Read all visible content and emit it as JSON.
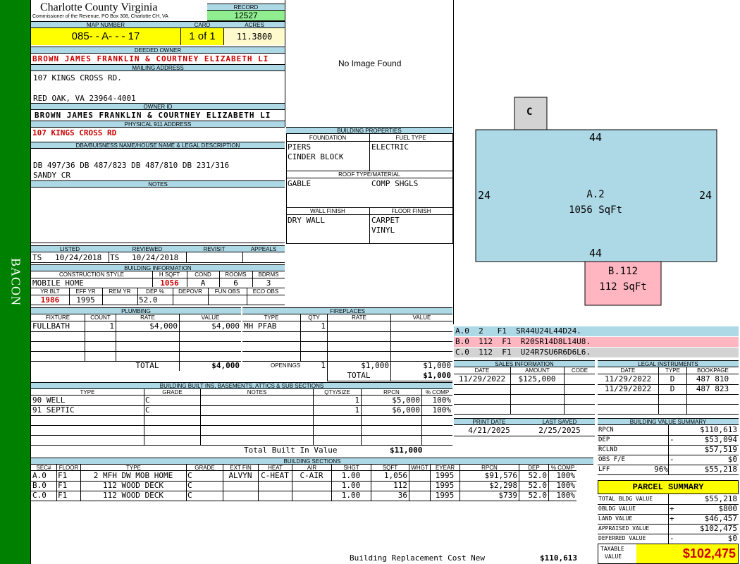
{
  "sidebar": {
    "district": "BACON"
  },
  "county": {
    "title": "Charlotte County Virginia",
    "sub": "Commissioner of the Revenue, PO Box 308, Charlotte CH, VA"
  },
  "record": {
    "label": "RECORD",
    "value": "12527"
  },
  "map": {
    "label": "MAP NUMBER",
    "value": "085- - A- - - 17"
  },
  "card": {
    "label": "CARD",
    "value": "1 of 1"
  },
  "acres": {
    "label": "ACRES",
    "value": "11.3800"
  },
  "owner": {
    "label": "DEEDED OWNER",
    "value": "BROWN JAMES FRANKLIN & COURTNEY ELIZABETH LI"
  },
  "mailing": {
    "label": "MAILING ADDRESS",
    "line1": "107 KINGS CROSS RD.",
    "line2": "RED OAK, VA 23964-4001"
  },
  "owner_id": {
    "label": "OWNER ID",
    "value": "BROWN JAMES FRANKLIN & COURTNEY ELIZABETH LI"
  },
  "address911": {
    "label": "PHYSICAL 911 ADDRESS",
    "value": "107 KINGS CROSS RD"
  },
  "legal": {
    "label": "DBA/BUISNESS NAME/HOUSE NAME & LEGAL DESCRIPTION",
    "line1": "DB 497/36 DB 487/823 DB 487/810 DB 231/316",
    "line2": "SANDY CR"
  },
  "notes": {
    "label": "NOTES"
  },
  "image": {
    "text": "No Image Found"
  },
  "status": {
    "listed_label": "LISTED",
    "listed_by": "TS",
    "listed": "10/24/2018",
    "reviewed_label": "REVIEWED",
    "reviewed_by": "TS",
    "reviewed": "10/24/2018",
    "revisit_label": "REVISIT",
    "appeals_label": "APPEALS"
  },
  "bldg_info": {
    "label": "BUILDING INFORMATION",
    "style_label": "CONSTRUCTION STYLE",
    "style": "MOBILE HOME",
    "hsqft_label": "H SQFT",
    "hsqft": "1056",
    "cond_label": "COND",
    "cond": "A",
    "rooms_label": "ROOMS",
    "rooms": "6",
    "bdrms_label": "BDRMS",
    "bdrms": "3",
    "yrblt_label": "YR BLT",
    "yrblt": "1986",
    "effyr_label": "EFF YR",
    "effyr": "1995",
    "remyr_label": "REM YR",
    "deppct_label": "DEP %",
    "deppct": "52.0",
    "depovr_label": "DEPOVR",
    "funobs_label": "FUN OBS",
    "ecoobs_label": "ECO OBS"
  },
  "bldg_props": {
    "label": "BUILDING PROPERTIES",
    "foundation_label": "FOUNDATION",
    "foundation1": "PIERS",
    "foundation2": "CINDER BLOCK",
    "fuel_label": "FUEL TYPE",
    "fuel": "ELECTRIC",
    "roof_label": "ROOF TYPE/MATERIAL",
    "roof1": "GABLE",
    "roof2": "COMP SHGLS",
    "wall_label": "WALL FINISH",
    "wall": "DRY WALL",
    "floor_label": "FLOOR FINISH",
    "floor1": "CARPET",
    "floor2": "VINYL"
  },
  "sketch": {
    "c_label": "C",
    "main_label": "A.2",
    "main_area": "1056 SqFt",
    "top": "44",
    "bottom": "44",
    "left": "24",
    "right": "24",
    "b_label": "B.112",
    "b_area": "112 SqFt"
  },
  "sketch_legend": [
    {
      "text": "A.0  2   F1  SR44U24L44D24.",
      "color": "#add8e6"
    },
    {
      "text": "B.0  112  F1  R20SR14D8L14U8.",
      "color": "#ffb6c1"
    },
    {
      "text": "C.0  112  F1  U24R7SU6R6D6L6.",
      "color": "#d3d3d3"
    }
  ],
  "plumbing": {
    "label": "PLUMBING",
    "headers": [
      "FIXTURE",
      "COUNT",
      "RATE",
      "VALUE"
    ],
    "rows": [
      [
        "FULLBATH",
        "1",
        "$4,000",
        "$4,000"
      ]
    ],
    "total_label": "TOTAL",
    "total": "$4,000"
  },
  "fireplaces": {
    "label": "FIREPLACES",
    "headers": [
      "TYPE",
      "QTY",
      "RATE",
      "VALUE"
    ],
    "rows": [
      [
        "MH PFAB",
        "1",
        "",
        ""
      ]
    ],
    "openings_label": "OPENINGS",
    "openings_qty": "1",
    "openings_rate": "$1,000",
    "openings_value": "$1,000",
    "total_label": "TOTAL",
    "total": "$1,000"
  },
  "sales": {
    "label": "SALES INFORMATION",
    "headers": [
      "DATE",
      "AMOUNT",
      "CODE"
    ],
    "rows": [
      [
        "11/29/2022",
        "$125,000",
        ""
      ]
    ]
  },
  "legal_inst": {
    "label": "LEGAL INSTRUMENTS",
    "headers": [
      "DATE",
      "TYPE",
      "BOOKPAGE"
    ],
    "rows": [
      [
        "11/29/2022",
        "D",
        "487 810"
      ],
      [
        "11/29/2022",
        "D",
        "487 823"
      ]
    ]
  },
  "builtins": {
    "label": "BUILDING BUILT INS, BASEMENTS, ATTICS & SUB SECTIONS",
    "headers": [
      "TYPE",
      "GRADE",
      "NOTES",
      "QTY/SIZE",
      "RPCN",
      "% COMP"
    ],
    "rows": [
      [
        "90 WELL",
        "C",
        "",
        "1",
        "$5,000",
        "100%"
      ],
      [
        "91 SEPTIC",
        "C",
        "",
        "1",
        "$6,000",
        "100%"
      ]
    ],
    "total_label": "Total Built In Value",
    "total": "$11,000"
  },
  "print": {
    "print_label": "PRINT DATE",
    "print_date": "4/21/2025",
    "saved_label": "LAST SAVED",
    "saved_date": "2/25/2025"
  },
  "value_summary": {
    "label": "BUILDING VALUE SUMMARY",
    "rows": [
      {
        "label": "RPCN",
        "sign": "",
        "value": "$110,613"
      },
      {
        "label": "DEP",
        "sign": "-",
        "value": "$53,094"
      },
      {
        "label": "RCLND",
        "sign": "",
        "value": "$57,519"
      },
      {
        "label": "OBS F/E",
        "sign": "-",
        "value": "$0"
      },
      {
        "label": "LFF",
        "pct": "96%",
        "sign": "",
        "value": "$55,218"
      }
    ]
  },
  "parcel": {
    "label": "PARCEL SUMMARY",
    "rows": [
      {
        "label": "TOTAL BLDG VALUE",
        "sign": "",
        "value": "$55,218"
      },
      {
        "label": "OBLDG VALUE",
        "sign": "+",
        "value": "$800"
      },
      {
        "label": "LAND VALUE",
        "sign": "+",
        "value": "$46,457"
      },
      {
        "label": "APPRAISED VALUE",
        "sign": "",
        "value": "$102,475"
      },
      {
        "label": "DEFERRED VALUE",
        "sign": "-",
        "value": "$0"
      }
    ],
    "taxable_label1": "TAXABLE",
    "taxable_label2": "VALUE",
    "taxable": "$102,475"
  },
  "sections": {
    "label": "BUILDING SECTIONS",
    "headers": [
      "SEC#",
      "FLOOR",
      "TYPE",
      "GRADE",
      "EXT FIN",
      "HEAT",
      "AIR",
      "SHGT",
      "SQFT",
      "WHGT",
      "EYEAR",
      "RPCN",
      "DEP",
      "% COMP"
    ],
    "rows": [
      [
        "A.0",
        "F1",
        "2 MFH DW MOB HOME",
        "C",
        "ALVYN",
        "C-HEAT",
        "C-AIR",
        "1.00",
        "1,056",
        "",
        "1995",
        "$91,576",
        "52.0",
        "100%"
      ],
      [
        "B.0",
        "F1",
        "112 WOOD DECK",
        "C",
        "",
        "",
        "",
        "1.00",
        "112",
        "",
        "1995",
        "$2,298",
        "52.0",
        "100%"
      ],
      [
        "C.0",
        "F1",
        "112 WOOD DECK",
        "C",
        "",
        "",
        "",
        "1.00",
        "36",
        "",
        "1995",
        "$739",
        "52.0",
        "100%"
      ]
    ],
    "total_label": "Building Replacement Cost New",
    "total": "$110,613"
  },
  "colors": {
    "sidebar": "#008000",
    "header": "#add8e6",
    "map": "#ffff00",
    "record": "#90ee90",
    "owner": "#cc0000",
    "main_area": "#add8e6",
    "deck": "#ffb6c1",
    "c_area": "#d3d3d3"
  }
}
